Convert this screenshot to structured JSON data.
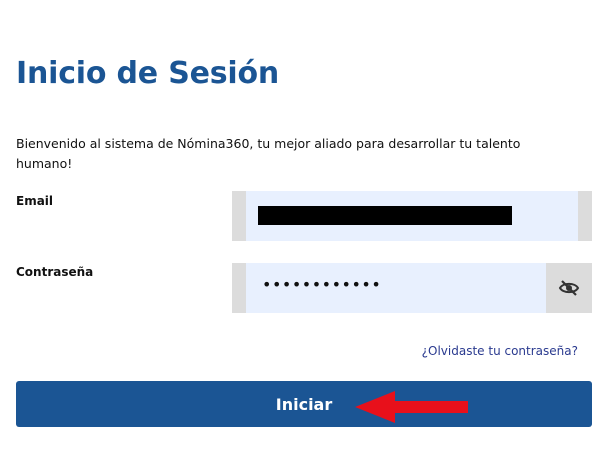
{
  "login": {
    "title": "Inicio de Sesión",
    "welcome_text": "Bienvenido al sistema de Nómina360, tu mejor aliado para desarrollar tu talento humano!",
    "email_label": "Email",
    "password_label": "Contraseña",
    "password_masked": "••••••••••••",
    "forgot_link": "¿Olvidaste tu contraseña?",
    "submit_label": "Iniciar"
  },
  "icons": {
    "toggle_password": "eye-slash-icon",
    "annotation": "red-arrow-icon"
  },
  "colors": {
    "brand": "#1b5594",
    "field_bg": "#e8f0fe",
    "field_border": "#dcdcdc",
    "link": "#2a3a8f",
    "annotation_arrow": "#e8101b"
  }
}
